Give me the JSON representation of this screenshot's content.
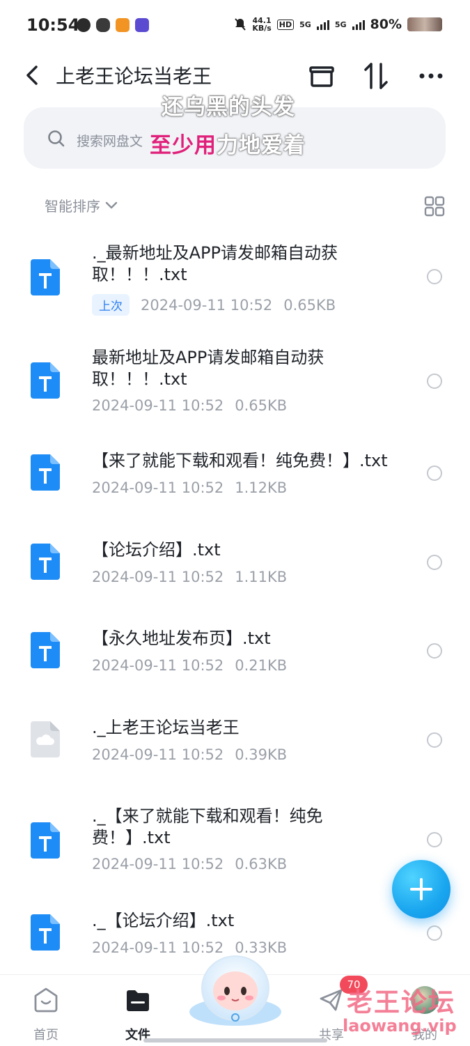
{
  "status_bar": {
    "time": "10:54",
    "net_speed_value": "44.1",
    "net_speed_unit": "KB/s",
    "hd_label": "HD",
    "sim1": "5G",
    "sim2": "5G",
    "battery": "80%"
  },
  "header": {
    "title": "上老王论坛当老王",
    "actions": [
      "archive-icon",
      "sort-arrows-icon",
      "more-icon"
    ]
  },
  "overlay_lyrics": {
    "line1": "还乌黑的头发",
    "line2_highlight": "至少用",
    "line2_rest": "力地爱着"
  },
  "search": {
    "placeholder": "搜索网盘文"
  },
  "sort": {
    "label": "智能排序"
  },
  "files": [
    {
      "name_line1": "._最新地址及APP请发邮箱自动获",
      "name_line2": "取！！！.txt",
      "tag": "上次",
      "date": "2024-09-11  10:52",
      "size": "0.65KB",
      "icon": "text-file-icon"
    },
    {
      "name_line1": "最新地址及APP请发邮箱自动获",
      "name_line2": "取！！！.txt",
      "date": "2024-09-11  10:52",
      "size": "0.65KB",
      "icon": "text-file-icon"
    },
    {
      "name_line1": "【来了就能下载和观看！纯免费！】.txt",
      "date": "2024-09-11  10:52",
      "size": "1.12KB",
      "icon": "text-file-icon"
    },
    {
      "name_line1": "【论坛介绍】.txt",
      "date": "2024-09-11  10:52",
      "size": "1.11KB",
      "icon": "text-file-icon"
    },
    {
      "name_line1": "【永久地址发布页】.txt",
      "date": "2024-09-11  10:52",
      "size": "0.21KB",
      "icon": "text-file-icon"
    },
    {
      "name_line1": "._上老王论坛当老王",
      "date": "2024-09-11  10:52",
      "size": "0.39KB",
      "icon": "cloud-file-icon"
    },
    {
      "name_line1": "._【来了就能下载和观看！纯免",
      "name_line2": "费！】.txt",
      "date": "2024-09-11  10:52",
      "size": "0.63KB",
      "icon": "text-file-icon"
    },
    {
      "name_line1": "._【论坛介绍】.txt",
      "date": "2024-09-11  10:52",
      "size": "0.33KB",
      "icon": "text-file-icon"
    }
  ],
  "bottom_nav": {
    "items": [
      {
        "label": "首页",
        "icon": "home-icon"
      },
      {
        "label": "文件",
        "icon": "folder-icon",
        "active": true
      },
      {
        "label": "",
        "icon": "mascot-icon"
      },
      {
        "label": "共享",
        "icon": "send-icon",
        "badge": "70"
      },
      {
        "label": "我的",
        "icon": "avatar"
      }
    ]
  },
  "watermark": {
    "line1": "老王论坛",
    "line2": "laowang.vip"
  },
  "colors": {
    "accent": "#1aa6ef",
    "file_icon": "#1e8cf6",
    "badge": "#f24a5a",
    "highlight_text": "#e0207a"
  }
}
